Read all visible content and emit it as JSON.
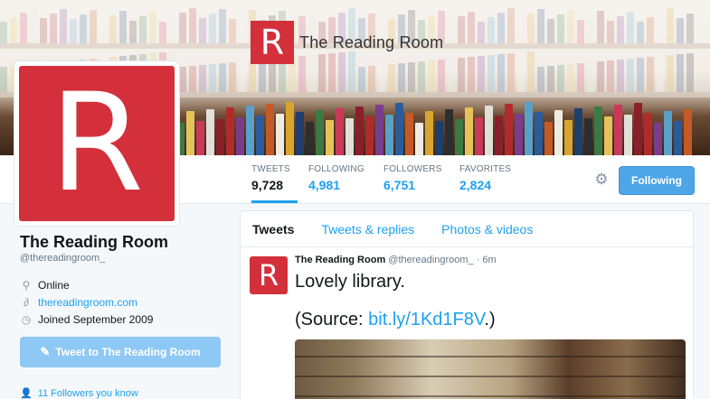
{
  "header": {
    "banner_logo_letter": "R",
    "banner_logo_text": "The Reading Room",
    "avatar_letter": "R"
  },
  "stats": [
    {
      "label": "TWEETS",
      "value": "9,728",
      "active": true
    },
    {
      "label": "FOLLOWING",
      "value": "4,981",
      "active": false
    },
    {
      "label": "FOLLOWERS",
      "value": "6,751",
      "active": false
    },
    {
      "label": "FAVORITES",
      "value": "2,824",
      "active": false
    }
  ],
  "actions": {
    "gear_icon": "gear-icon",
    "follow_label": "Following"
  },
  "profile": {
    "name": "The Reading Room",
    "handle": "@thereadingroom_",
    "location": "Online",
    "website": "thereadingroom.com",
    "joined": "Joined September 2009",
    "tweet_to_label": "Tweet to The Reading Room",
    "followers_you_know": "11 Followers you know"
  },
  "timeline": {
    "tabs": [
      "Tweets",
      "Tweets & replies",
      "Photos & videos"
    ],
    "tweet": {
      "avatar_letter": "R",
      "name": "The Reading Room",
      "handle": "@thereadingroom_",
      "time": "· 6m",
      "text": "Lovely library.",
      "source_prefix": "(Source: ",
      "source_link": "bit.ly/1Kd1F8V",
      "source_suffix": ".)"
    }
  },
  "colors": {
    "brand_red": "#d3303b",
    "link_blue": "#1da1f2",
    "follow_button": "#4ea5e8"
  }
}
